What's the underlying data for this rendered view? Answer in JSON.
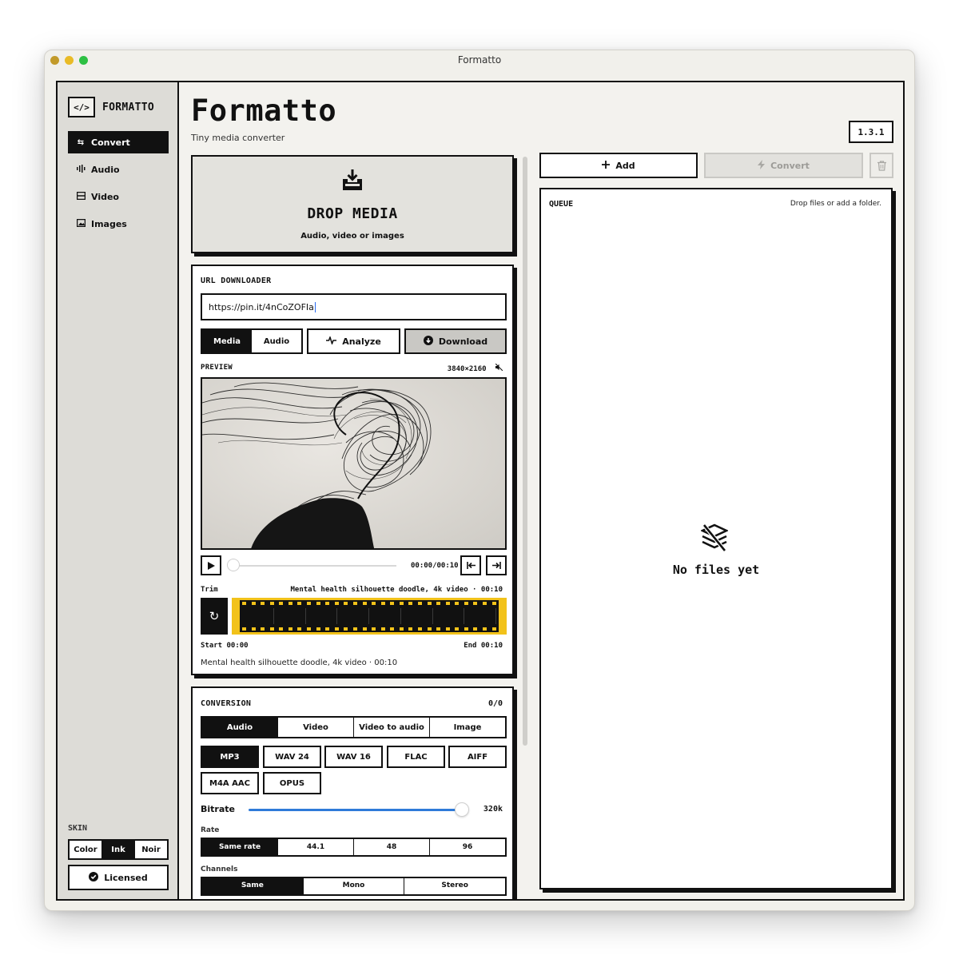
{
  "window": {
    "title": "Formatto"
  },
  "sidebar": {
    "brand_mark": "</>",
    "brand_name": "FORMATTO",
    "items": [
      {
        "label": "Convert",
        "icon": "swap-icon",
        "active": true
      },
      {
        "label": "Audio",
        "icon": "waveform-icon"
      },
      {
        "label": "Video",
        "icon": "film-icon"
      },
      {
        "label": "Images",
        "icon": "image-icon"
      }
    ],
    "skin_label": "SKIN",
    "skins": [
      "Color",
      "Ink",
      "Noir"
    ],
    "skin_selected": "Ink",
    "licensed_label": "Licensed"
  },
  "header": {
    "title": "Formatto",
    "subtitle": "Tiny media converter",
    "version": "1.3.1"
  },
  "drop": {
    "heading": "DROP MEDIA",
    "sub": "Audio, video or images"
  },
  "url_downloader": {
    "label": "URL DOWNLOADER",
    "url_value": "https://pin.it/4nCoZOFIa",
    "modes": [
      "Media",
      "Audio"
    ],
    "analyze_label": "Analyze",
    "download_label": "Download",
    "preview_label": "PREVIEW",
    "resolution": "3840×2160",
    "timecode": "00:00/00:10",
    "trim_label": "Trim",
    "trim_meta": "Mental health silhouette doodle, 4k video · 00:10",
    "start_label": "Start 00:00",
    "end_label": "End 00:10",
    "caption": "Mental health silhouette doodle, 4k video · 00:10"
  },
  "conversion": {
    "label": "CONVERSION",
    "count": "0/0",
    "tabs": [
      "Audio",
      "Video",
      "Video to audio",
      "Image"
    ],
    "formats": [
      "MP3",
      "WAV 24",
      "WAV 16",
      "FLAC",
      "AIFF",
      "M4A AAC",
      "OPUS"
    ],
    "bitrate_label": "Bitrate",
    "bitrate_value": "320k",
    "rate_label": "Rate",
    "rates": [
      "Same rate",
      "44.1",
      "48",
      "96"
    ],
    "channels_label": "Channels",
    "channels": [
      "Same",
      "Mono",
      "Stereo"
    ]
  },
  "toolbar": {
    "add_label": "Add",
    "convert_label": "Convert"
  },
  "queue": {
    "label": "QUEUE",
    "hint": "Drop files or add a folder.",
    "empty_text": "No files yet"
  },
  "colors": {
    "accent": "#111111",
    "film_yellow": "#f2c21a",
    "slider_blue": "#2f7bd9"
  }
}
